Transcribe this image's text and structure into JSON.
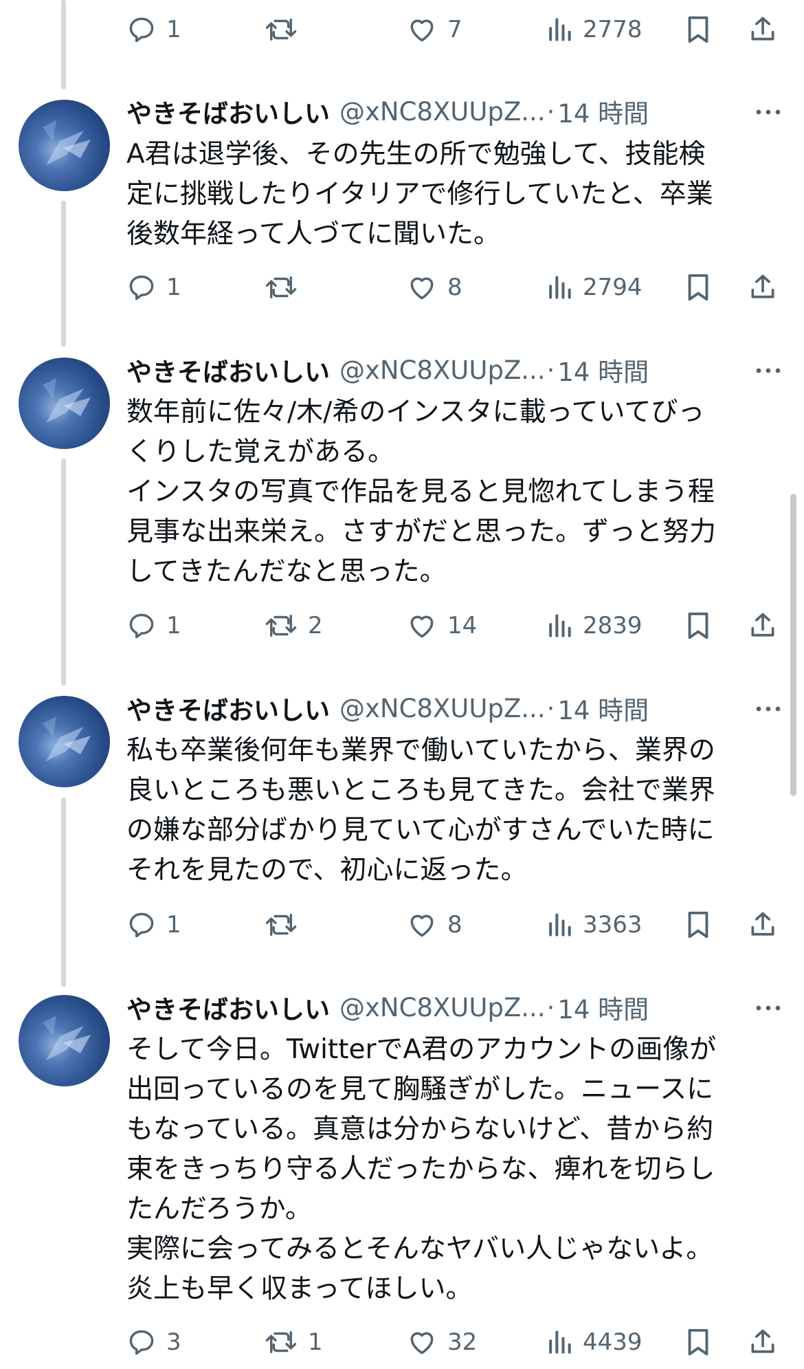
{
  "top_actions": {
    "replies": "1",
    "retweets": "",
    "likes": "7",
    "views": "2778"
  },
  "tweets": [
    {
      "name": "やきそばおいしい",
      "handle": "@xNC8XUUpZ...",
      "time": "14 時間",
      "text": "A君は退学後、その先生の所で勉強して、技能検\n定に挑戦したりイタリアで修行していたと、卒業\n後数年経って人づてに聞いた。",
      "replies": "1",
      "retweets": "",
      "likes": "8",
      "views": "2794"
    },
    {
      "name": "やきそばおいしい",
      "handle": "@xNC8XUUpZ...",
      "time": "14 時間",
      "text": "数年前に佐々/木/希のインスタに載っていてびっ\nくりした覚えがある。\nインスタの写真で作品を見ると見惚れてしまう程\n見事な出来栄え。さすがだと思った。ずっと努力\nしてきたんだなと思った。",
      "replies": "1",
      "retweets": "2",
      "likes": "14",
      "views": "2839"
    },
    {
      "name": "やきそばおいしい",
      "handle": "@xNC8XUUpZ...",
      "time": "14 時間",
      "text": "私も卒業後何年も業界で働いていたから、業界の\n良いところも悪いところも見てきた。会社で業界\nの嫌な部分ばかり見ていて心がすさんでいた時に\nそれを見たので、初心に返った。",
      "replies": "1",
      "retweets": "",
      "likes": "8",
      "views": "3363"
    },
    {
      "name": "やきそばおいしい",
      "handle": "@xNC8XUUpZ...",
      "time": "14 時間",
      "text": "そして今日。TwitterでA君のアカウントの画像が\n出回っているのを見て胸騒ぎがした。ニュースに\nもなっている。真意は分からないけど、昔から約\n束をきっちり守る人だったからな、痺れを切らし\nたんだろうか。\n実際に会ってみるとそんなヤバい人じゃないよ。\n炎上も早く収まってほしい。",
      "replies": "3",
      "retweets": "1",
      "likes": "32",
      "views": "4439"
    }
  ],
  "icons": {
    "reply": "reply-icon",
    "retweet": "retweet-icon",
    "like": "heart-icon",
    "views": "views-icon",
    "bookmark": "bookmark-icon",
    "share": "share-icon",
    "more": "more-icon"
  },
  "colors": {
    "text": "#0f1419",
    "muted": "#536471",
    "thread_line": "#cfd9de"
  }
}
